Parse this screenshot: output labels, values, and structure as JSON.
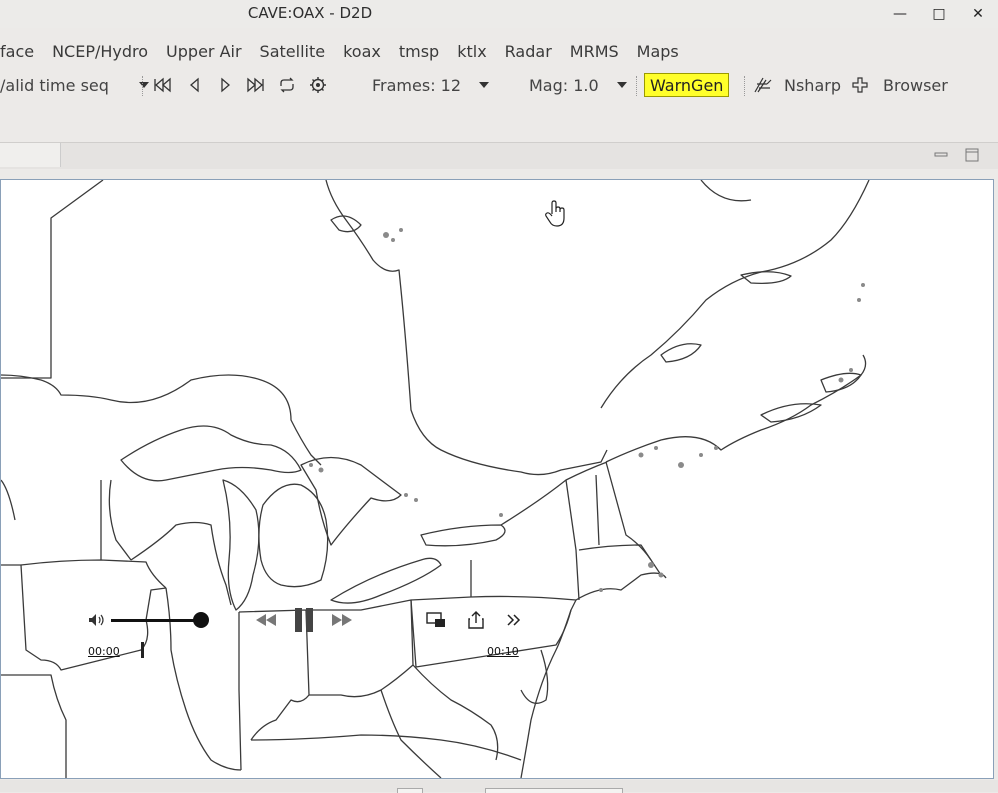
{
  "window": {
    "title": "CAVE:OAX - D2D",
    "minimize_glyph": "—",
    "maximize_glyph": "□",
    "close_glyph": "✕"
  },
  "menubar": {
    "items": [
      "face",
      "NCEP/Hydro",
      "Upper Air",
      "Satellite",
      "koax",
      "tmsp",
      "ktlx",
      "Radar",
      "MRMS",
      "Maps"
    ]
  },
  "toolbar": {
    "time_mode": "/alid time seq",
    "frames_label": "Frames: 12",
    "mag_label": "Mag: 1.0",
    "warngen_label": "WarnGen",
    "nsharp_label": "Nsharp",
    "browser_label": "Browser",
    "icons": [
      "first-frame-icon",
      "step-back-icon",
      "step-forward-icon",
      "last-frame-icon",
      "loop-icon",
      "loop-properties-icon",
      "nsharp-icon",
      "browser-icon"
    ]
  },
  "media": {
    "start_time": "00:00",
    "end_time": "00:10",
    "volume_level": 1.0
  },
  "colors": {
    "warngen_bg": "#ffff2a",
    "map_line": "#3a3a3a",
    "coast_fill": "#8a8a8a"
  }
}
